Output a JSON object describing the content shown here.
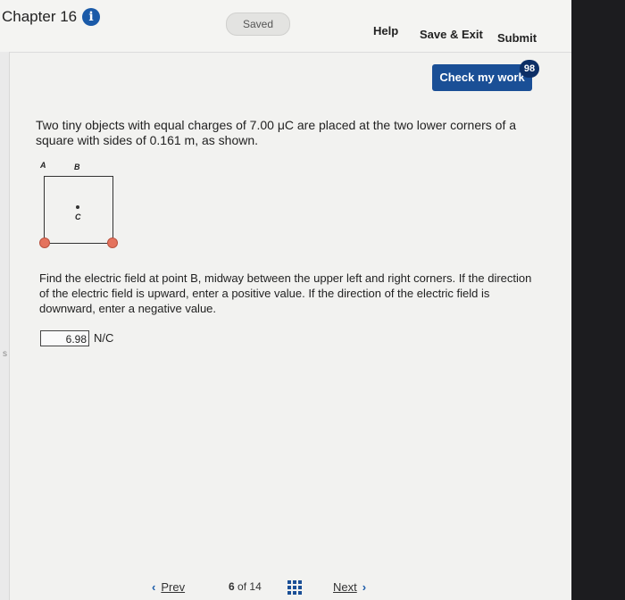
{
  "header": {
    "chapter_title": "Chapter 16",
    "info_icon": "info-icon",
    "saved_label": "Saved",
    "help_label": "Help",
    "save_exit_label": "Save & Exit",
    "submit_label": "Submit"
  },
  "check_work": {
    "label": "Check my work",
    "badge": "98"
  },
  "question": {
    "text": "Two tiny objects with equal charges of 7.00 μC are placed at the two lower corners of a square with sides of 0.161 m, as shown.",
    "diagram": {
      "label_a": "A",
      "label_b": "B",
      "label_c": "C"
    },
    "prompt": "Find the electric field at point B, midway between the upper left and right corners. If the direction of the electric field is upward, enter a positive value. If the direction of the electric field is downward, enter a negative value."
  },
  "answer": {
    "value": "6.98",
    "unit": "N/C"
  },
  "pager": {
    "prev_label": "Prev",
    "current": "6",
    "of_label": "of",
    "total": "14",
    "next_label": "Next"
  },
  "sidebar": {
    "edge_letter": "s"
  },
  "colors": {
    "accent": "#1a4f96",
    "charge": "#e4735d"
  }
}
